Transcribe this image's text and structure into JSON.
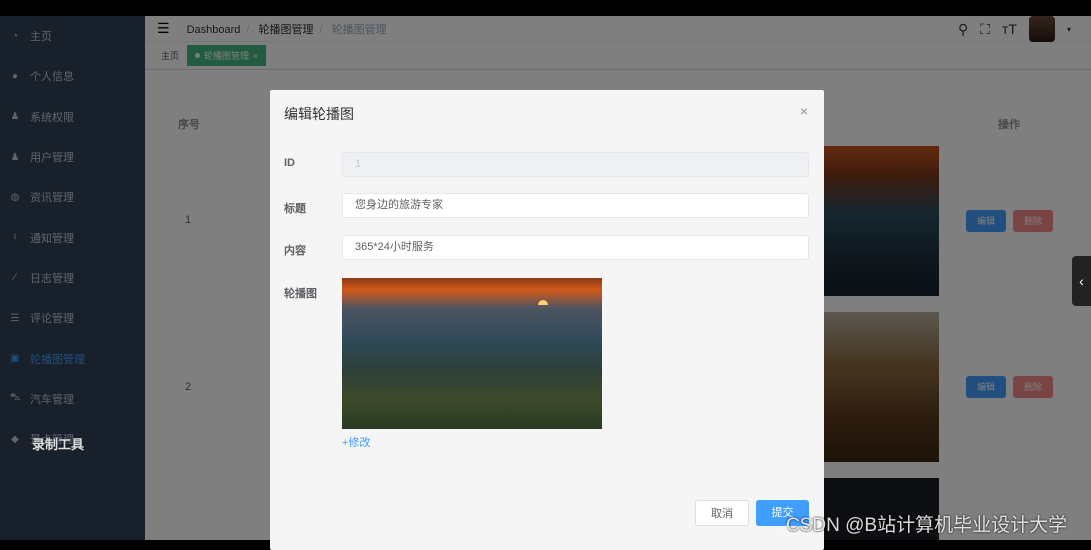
{
  "sidebar": {
    "items": [
      {
        "label": "主页",
        "icon": "dashboard-icon",
        "active": false
      },
      {
        "label": "个人信息",
        "icon": "user-icon",
        "active": false
      },
      {
        "label": "系统权限",
        "icon": "user-lock-icon",
        "active": false
      },
      {
        "label": "用户管理",
        "icon": "users-icon",
        "active": false
      },
      {
        "label": "资讯管理",
        "icon": "globe-icon",
        "active": false
      },
      {
        "label": "通知管理",
        "icon": "bell-icon",
        "active": false
      },
      {
        "label": "日志管理",
        "icon": "feather-icon",
        "active": false
      },
      {
        "label": "评论管理",
        "icon": "list-icon",
        "active": false
      },
      {
        "label": "轮播图管理",
        "icon": "image-icon",
        "active": true
      },
      {
        "label": "汽车管理",
        "icon": "car-icon",
        "active": false
      },
      {
        "label": "景点管理",
        "icon": "location-icon",
        "active": false
      }
    ]
  },
  "header": {
    "breadcrumb": [
      "Dashboard",
      "轮播图管理",
      "轮播图管理"
    ]
  },
  "tags": {
    "home": "主页",
    "active": "轮播图管理",
    "close": "×"
  },
  "table": {
    "headers": {
      "index": "序号",
      "actions": "操作"
    },
    "rows": [
      {
        "index": "1",
        "edit": "编辑",
        "delete": "删除"
      },
      {
        "index": "2",
        "edit": "编辑",
        "delete": "删除"
      }
    ]
  },
  "modal": {
    "title": "编辑轮播图",
    "close": "×",
    "fields": {
      "id_label": "ID",
      "id_value": "1",
      "title_label": "标题",
      "title_value": "您身边的旅游专家",
      "content_label": "内容",
      "content_value": "365*24小时服务",
      "image_label": "轮播图"
    },
    "modify_link": "+修改",
    "cancel": "取消",
    "submit": "提交"
  },
  "watermark": "CSDN @B站计算机毕业设计大学",
  "recorder_watermark": "录制工具",
  "colors": {
    "primary": "#409eff",
    "sidebar": "#304156",
    "tag_active": "#42b983",
    "danger": "#f56c6c"
  }
}
